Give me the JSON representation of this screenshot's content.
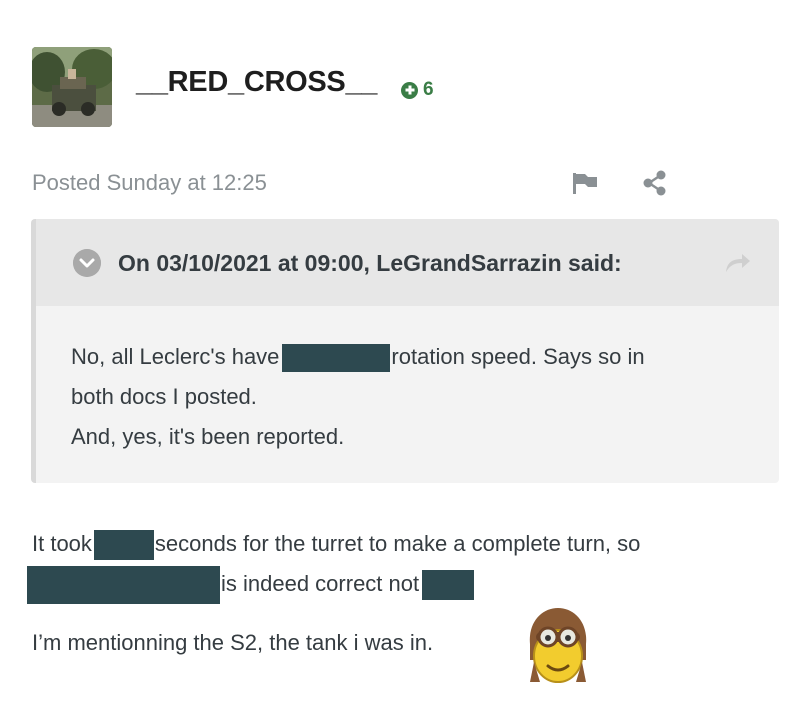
{
  "author": {
    "username": "__RED_CROSS__",
    "reputation": "6",
    "avatar_icon": "avatar-tank-photo"
  },
  "post_meta": {
    "posted_text": "Posted Sunday at 12:25"
  },
  "quote": {
    "header": "On 03/10/2021 at 09:00, LeGrandSarrazin said:",
    "line1_a": "No, all Leclerc's have",
    "line1_b": "rotation speed. Says so in",
    "line2": "both docs I posted.",
    "line3": "And, yes, it's been reported."
  },
  "body": {
    "p1_a": "It took",
    "p1_b": "seconds for the turret to make a complete turn, so",
    "p2_a": "is indeed correct not",
    "p3": "I’m mentionning the S2, the tank i was in."
  },
  "colors": {
    "redaction": "#2d4950",
    "reputation": "#3a7d46"
  }
}
